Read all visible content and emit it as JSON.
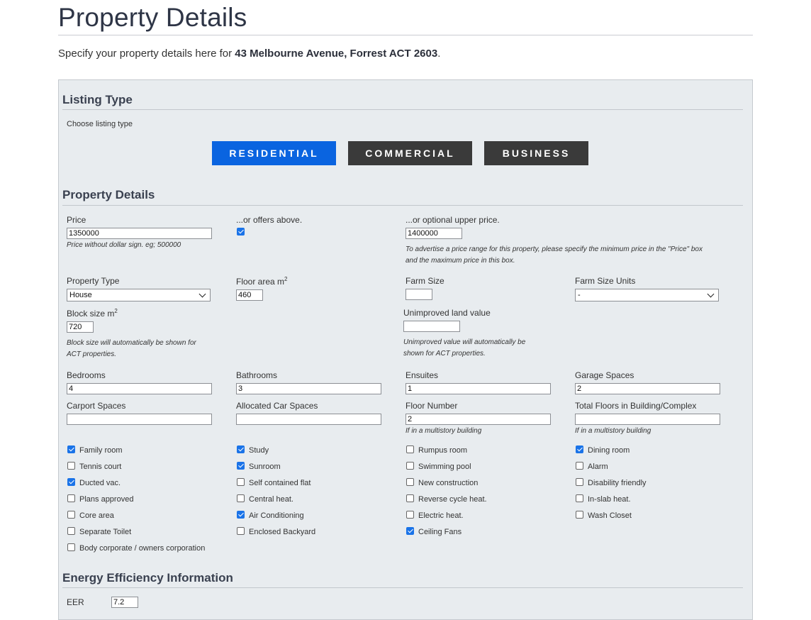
{
  "page": {
    "title": "Property Details",
    "intro_prefix": "Specify your property details here for ",
    "intro_address": "43 Melbourne Avenue, Forrest ACT 2603",
    "intro_suffix": "."
  },
  "listing_type": {
    "heading": "Listing Type",
    "prompt": "Choose listing type",
    "buttons": [
      "RESIDENTIAL",
      "COMMERCIAL",
      "BUSINESS"
    ],
    "selected": "RESIDENTIAL",
    "active_color": "#0a64e0",
    "inactive_color": "#3a3a3a"
  },
  "property_details": {
    "heading": "Property Details",
    "price": {
      "label": "Price",
      "value": "1350000",
      "hint": "Price without dollar sign. eg; 500000"
    },
    "offers_above": {
      "label": "...or offers above.",
      "checked": true
    },
    "upper_price": {
      "label": "...or optional upper price.",
      "value": "1400000",
      "hint_line1": "To advertise a price range for this property, please specify the minimum price in the \"Price\" box",
      "hint_line2": "and the maximum price in this box."
    },
    "property_type": {
      "label": "Property Type",
      "value": "House"
    },
    "floor_area": {
      "label": "Floor area m",
      "sup": "2",
      "value": "460"
    },
    "farm_size": {
      "label": "Farm Size",
      "value": ""
    },
    "farm_size_units": {
      "label": "Farm Size Units",
      "value": "-"
    },
    "block_size": {
      "label": "Block size m",
      "sup": "2",
      "value": "720",
      "hint_line1": "Block size will automatically be shown for",
      "hint_line2": "ACT properties."
    },
    "unimproved_land_value": {
      "label": "Unimproved land value",
      "value": "",
      "hint_line1": "Unimproved value will automatically be",
      "hint_line2": "shown for ACT properties."
    },
    "bedrooms": {
      "label": "Bedrooms",
      "value": "4"
    },
    "bathrooms": {
      "label": "Bathrooms",
      "value": "3"
    },
    "ensuites": {
      "label": "Ensuites",
      "value": "1"
    },
    "garage_spaces": {
      "label": "Garage Spaces",
      "value": "2"
    },
    "carport_spaces": {
      "label": "Carport Spaces",
      "value": ""
    },
    "allocated_car_spaces": {
      "label": "Allocated Car Spaces",
      "value": ""
    },
    "floor_number": {
      "label": "Floor Number",
      "value": "2",
      "hint": "If in a multistory building"
    },
    "total_floors": {
      "label": "Total Floors in Building/Complex",
      "value": "",
      "hint": "If in a multistory building"
    },
    "features": [
      [
        {
          "label": "Family room",
          "checked": true
        },
        {
          "label": "Tennis court",
          "checked": false
        },
        {
          "label": "Ducted vac.",
          "checked": true
        },
        {
          "label": "Plans approved",
          "checked": false
        },
        {
          "label": "Core area",
          "checked": false
        },
        {
          "label": "Separate Toilet",
          "checked": false
        },
        {
          "label": "Body corporate / owners corporation",
          "checked": false
        }
      ],
      [
        {
          "label": "Study",
          "checked": true
        },
        {
          "label": "Sunroom",
          "checked": true
        },
        {
          "label": "Self contained flat",
          "checked": false
        },
        {
          "label": "Central heat.",
          "checked": false
        },
        {
          "label": "Air Conditioning",
          "checked": true
        },
        {
          "label": "Enclosed Backyard",
          "checked": false
        }
      ],
      [
        {
          "label": "Rumpus room",
          "checked": false
        },
        {
          "label": "Swimming pool",
          "checked": false
        },
        {
          "label": "New construction",
          "checked": false
        },
        {
          "label": "Reverse cycle heat.",
          "checked": false
        },
        {
          "label": "Electric heat.",
          "checked": false
        },
        {
          "label": "Ceiling Fans",
          "checked": true
        }
      ],
      [
        {
          "label": "Dining room",
          "checked": true
        },
        {
          "label": "Alarm",
          "checked": false
        },
        {
          "label": "Disability friendly",
          "checked": false
        },
        {
          "label": "In-slab heat.",
          "checked": false
        },
        {
          "label": "Wash Closet",
          "checked": false
        }
      ]
    ]
  },
  "energy": {
    "heading": "Energy Efficiency Information",
    "eer": {
      "label": "EER",
      "value": "7.2"
    }
  },
  "icons": {
    "select_arrow": "chevron-down-icon",
    "checkbox_check": "checkmark-icon"
  }
}
